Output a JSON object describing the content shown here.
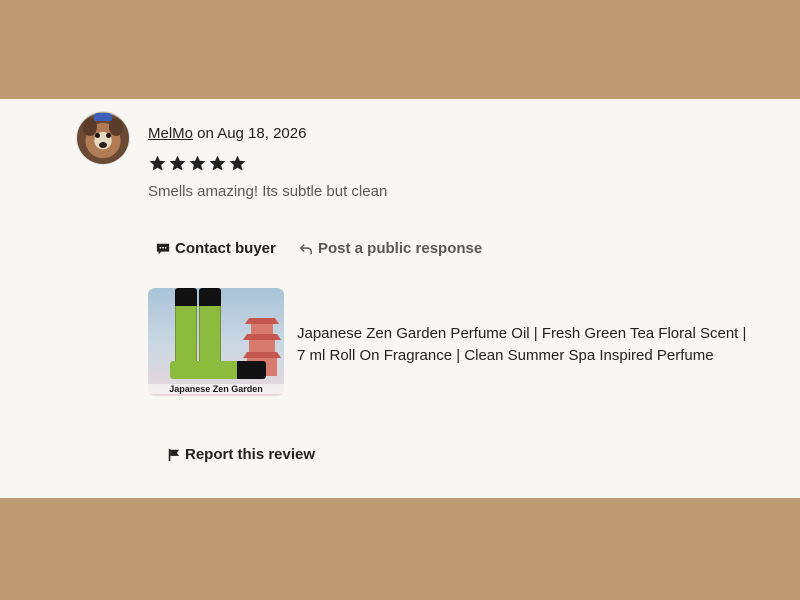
{
  "review": {
    "username": "MelMo",
    "date_text": " on Aug 18, 2026",
    "rating": 5,
    "rating_max": 5,
    "text": "Smells amazing! Its subtle but clean"
  },
  "actions": {
    "contact_label": "Contact buyer",
    "respond_label": "Post a public response",
    "report_label": "Report this review"
  },
  "product": {
    "image_label": "Japanese Zen Garden",
    "title": "Japanese Zen Garden Perfume Oil | Fresh Green Tea Floral Scent | 7 ml Roll On Fragrance | Clean Summer Spa Inspired Perfume"
  },
  "icons": {
    "star": "star-icon",
    "contact": "chat-bubble-icon",
    "respond": "reply-arrow-icon",
    "report": "flag-icon"
  },
  "colors": {
    "page_background": "#bd9a72",
    "card_background": "#f8f7f3",
    "star": "#222222",
    "muted_text": "#595959"
  }
}
